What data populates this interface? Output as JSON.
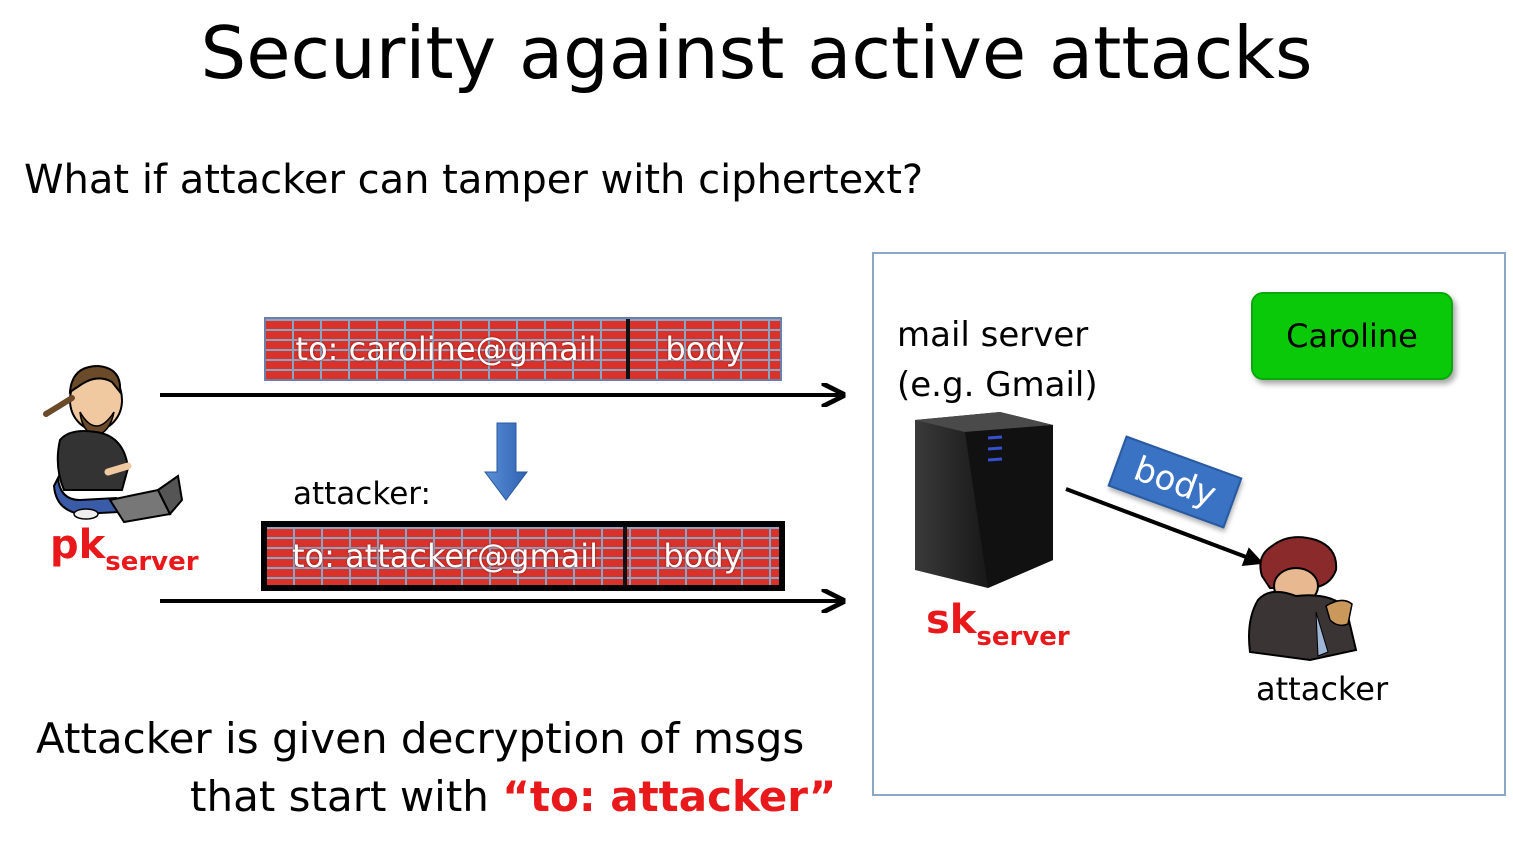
{
  "title": "Security against active attacks",
  "question": "What if attacker can tamper with ciphertext?",
  "message_original": {
    "to": "to: caroline@gmail",
    "body": "body"
  },
  "message_tampered_label": "attacker:",
  "message_tampered": {
    "to": "to: attacker@gmail",
    "body": "body"
  },
  "sender_key": {
    "main": "pk",
    "sub": "server"
  },
  "mail_server": {
    "line1": "mail server",
    "line2": "(e.g. Gmail)"
  },
  "server_key": {
    "main": "sk",
    "sub": "server"
  },
  "recipient": "Caroline",
  "forwarded_part": "body",
  "attacker_caption": "attacker",
  "conclusion": {
    "line1": "Attacker is given decryption of msgs",
    "line2_prefix": "that start with ",
    "line2_highlight": "“to: attacker”"
  },
  "colors": {
    "key_red": "#e8181b",
    "brick_red": "#d9322b",
    "caroline_green": "#09c909",
    "body_tag_blue": "#3a72c4"
  }
}
